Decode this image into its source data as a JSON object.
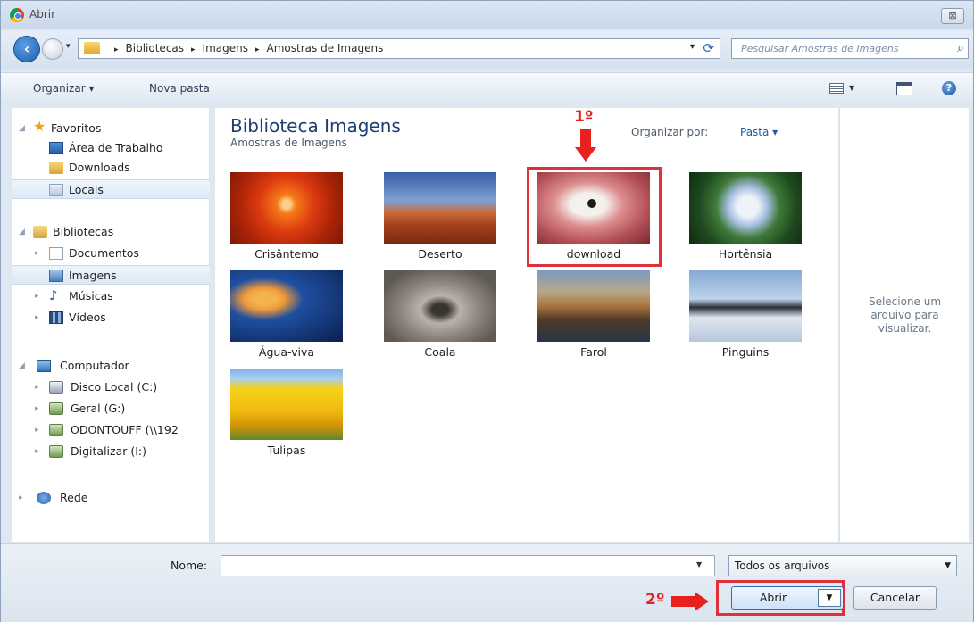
{
  "window": {
    "title": "Abrir",
    "close_glyph": "⊠"
  },
  "address": {
    "crumbs": [
      "Bibliotecas",
      "Imagens",
      "Amostras de Imagens"
    ],
    "search_placeholder": "Pesquisar Amostras de Imagens"
  },
  "commandbar": {
    "organize": "Organizar ▾",
    "new_folder": "Nova pasta"
  },
  "nav": {
    "favorites": "Favoritos",
    "desktop": "Área de Trabalho",
    "downloads": "Downloads",
    "locais": "Locais",
    "libraries": "Bibliotecas",
    "documents": "Documentos",
    "images": "Imagens",
    "music": "Músicas",
    "videos": "Vídeos",
    "computer": "Computador",
    "disk_c": "Disco Local (C:)",
    "geral": "Geral (G:)",
    "odonto": "ODONTOUFF (\\\\192",
    "digitalizar": "Digitalizar (I:)",
    "network": "Rede"
  },
  "content": {
    "library_title": "Biblioteca Imagens",
    "library_subtitle": "Amostras de Imagens",
    "arrange_label": "Organizar por:",
    "arrange_value": "Pasta ▾",
    "files": [
      "Crisântemo",
      "Deserto",
      "download",
      "Hortênsia",
      "Água-viva",
      "Coala",
      "Farol",
      "Pinguins",
      "Tulipas"
    ]
  },
  "preview": {
    "text": "Selecione um arquivo para visualizar."
  },
  "footer": {
    "name_label": "Nome:",
    "name_value": "",
    "filter": "Todos os arquivos",
    "open": "Abrir",
    "cancel": "Cancelar"
  },
  "annotations": {
    "step1": "1º",
    "step2": "2º"
  },
  "colors": {
    "annotation_red": "#e8211e",
    "title_blue": "#1e3f6f"
  }
}
